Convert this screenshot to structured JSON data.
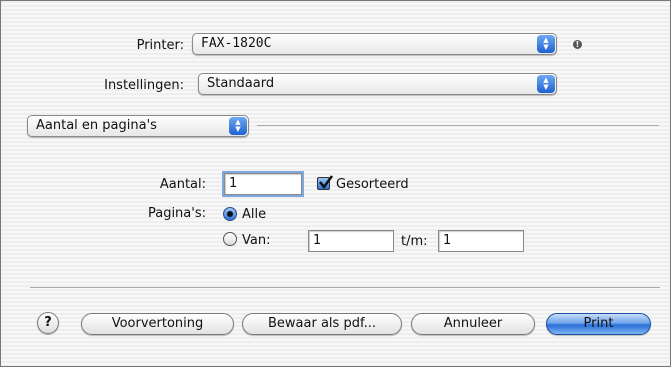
{
  "printer": {
    "label": "Printer:",
    "value": "FAX-1820C"
  },
  "settings": {
    "label": "Instellingen:",
    "value": "Standaard"
  },
  "panel": {
    "selected": "Aantal en pagina's"
  },
  "copies": {
    "label": "Aantal:",
    "value": "1",
    "collate_label": "Gesorteerd",
    "collate_checked": true
  },
  "pages": {
    "label": "Pagina's:",
    "all_label": "Alle",
    "from_label": "Van:",
    "from_value": "1",
    "to_label": "t/m:",
    "to_value": "1"
  },
  "buttons": {
    "help": "?",
    "preview": "Voorvertoning",
    "save_pdf": "Bewaar als pdf...",
    "cancel": "Annuleer",
    "print": "Print"
  },
  "icons": {
    "warning": "warning-icon",
    "stepper": "up-down-arrows-icon"
  }
}
